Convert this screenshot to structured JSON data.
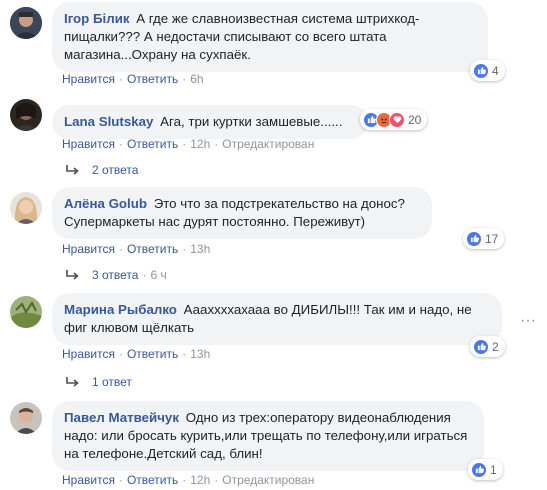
{
  "comments": [
    {
      "author": "Ігор Білик",
      "text": "А где же славноизвестная система штрихкод-пищалки??? А недостачи списывают со всего штата магазина...Охрану на сухпаёк.",
      "like_label": "Нравится",
      "reply_label": "Ответить",
      "time": "6h",
      "reaction_count": "4"
    },
    {
      "author": "Lana Slutskay",
      "text": "Ага, три куртки замшевые......",
      "like_label": "Нравится",
      "reply_label": "Ответить",
      "time": "12h",
      "edited": "Отредактирован",
      "reaction_count": "20",
      "replies_label": "2 ответа"
    },
    {
      "author": "Алёна Golub",
      "text": "Это что за подстрекательство на донос? Супермаркеты нас дурят постоянно. Переживут)",
      "like_label": "Нравится",
      "reply_label": "Ответить",
      "time": "13h",
      "reaction_count": "17",
      "replies_label": "3 ответа",
      "replies_time": "6 ч"
    },
    {
      "author": "Марина Рыбалко",
      "text": "Аааххххахааа во ДИБИЛЫ!!! Так им и надо, не фиг клювом щёлкать",
      "like_label": "Нравится",
      "reply_label": "Ответить",
      "time": "13h",
      "reaction_count": "2",
      "replies_label": "1 ответ"
    },
    {
      "author": "Павел Матвейчук",
      "text": "Одно из трех:оператору видеонаблюдения надо: или бросать курить,или трещать по телефону,или играться на телефоне.Детский сад, блин!",
      "like_label": "Нравится",
      "reply_label": "Ответить",
      "time": "12h",
      "edited": "Отредактирован",
      "reaction_count": "1"
    }
  ],
  "colors": {
    "link": "#385898",
    "bubble": "#f2f3f5",
    "meta": "#90949c",
    "like": "#4a78e8"
  }
}
